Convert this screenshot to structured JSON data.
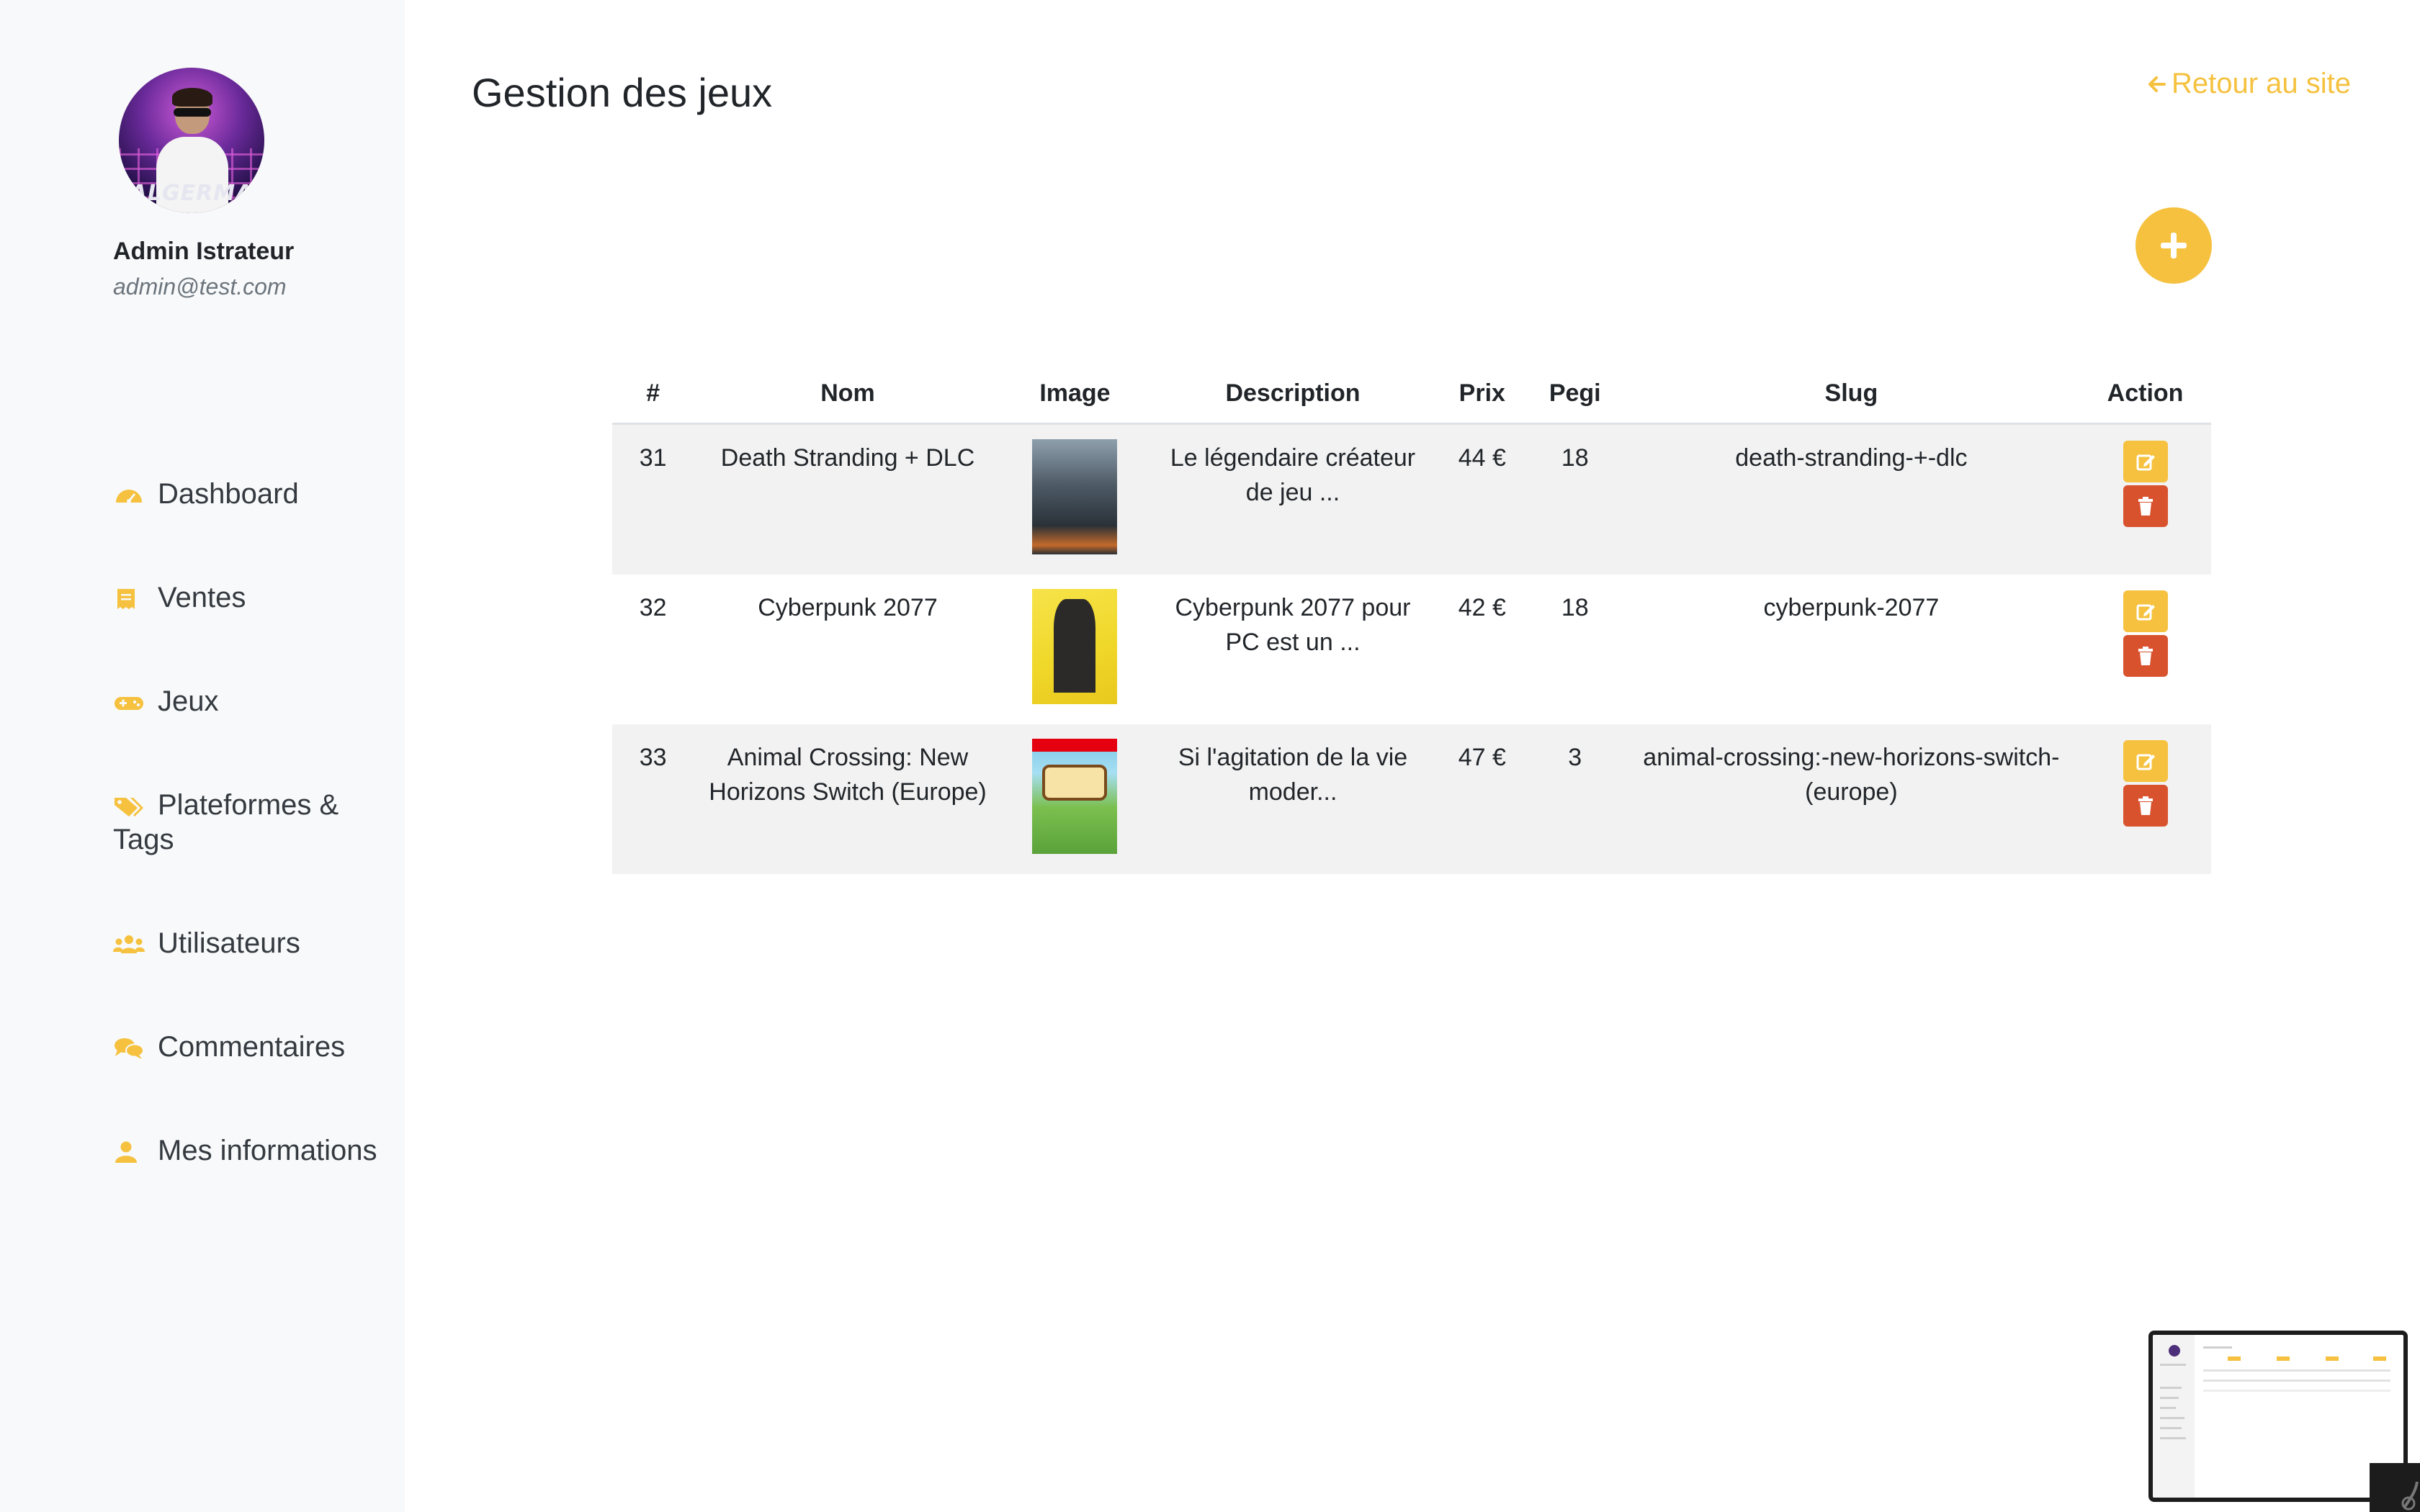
{
  "colors": {
    "accent": "#f5c13e",
    "danger": "#d9522e",
    "sidebar_bg": "#f8f9fa",
    "row_stripe": "#f2f2f2"
  },
  "user": {
    "name": "Admin Istrateur",
    "email": "admin@test.com",
    "avatar_logo_text": "ALGERMA"
  },
  "nav": [
    {
      "label": "Dashboard",
      "icon": "dashboard-gauge-icon"
    },
    {
      "label": "Ventes",
      "icon": "receipt-icon"
    },
    {
      "label": "Jeux",
      "icon": "gamepad-icon"
    },
    {
      "label": "Plateformes & Tags",
      "icon": "tags-icon"
    },
    {
      "label": "Utilisateurs",
      "icon": "users-icon"
    },
    {
      "label": "Commentaires",
      "icon": "comments-icon"
    },
    {
      "label": "Mes informations",
      "icon": "user-icon"
    }
  ],
  "header": {
    "title": "Gestion des jeux",
    "back_link": "Retour au site",
    "back_icon": "arrow-left-icon"
  },
  "add_button_icon": "plus-icon",
  "table": {
    "columns": [
      "#",
      "Nom",
      "Image",
      "Description",
      "Prix",
      "Pegi",
      "Slug",
      "Action"
    ],
    "rows": [
      {
        "id": "31",
        "name": "Death Stranding + DLC",
        "image": "death-stranding-cover",
        "description": "Le légendaire créateur de jeu ...",
        "price": "44 €",
        "pegi": "18",
        "slug": "death-stranding-+-dlc"
      },
      {
        "id": "32",
        "name": "Cyberpunk 2077",
        "image": "cyberpunk-2077-cover",
        "description": "Cyberpunk 2077 pour PC est un ...",
        "price": "42 €",
        "pegi": "18",
        "slug": "cyberpunk-2077"
      },
      {
        "id": "33",
        "name": "Animal Crossing: New Horizons Switch (Europe)",
        "image": "animal-crossing-cover",
        "description": "Si l'agitation de la vie moder...",
        "price": "47 €",
        "pegi": "3",
        "slug": "animal-crossing:-new-horizons-switch-(europe)"
      }
    ],
    "action_icons": {
      "edit": "edit-icon",
      "delete": "trash-icon"
    }
  }
}
